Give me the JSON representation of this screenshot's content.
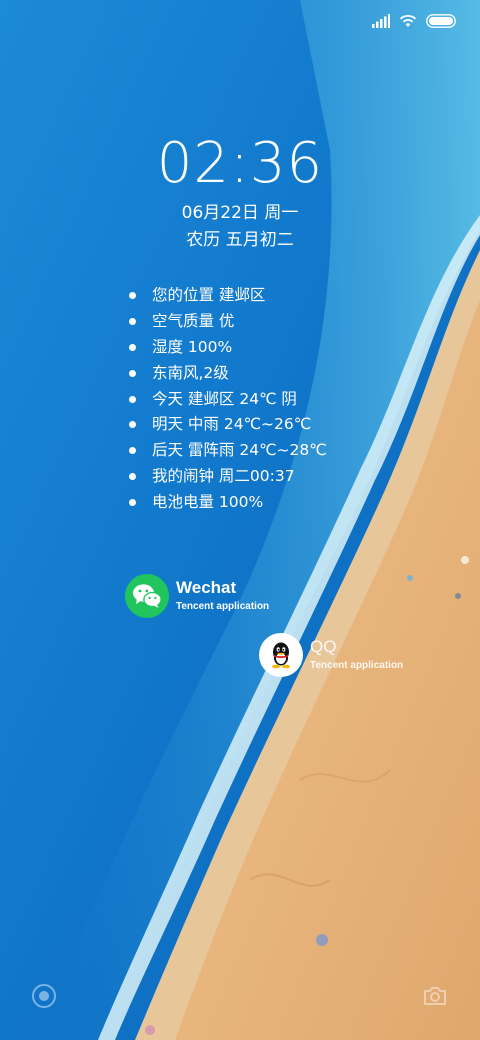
{
  "lockscreen": {
    "time": "02:36",
    "date": "06月22日 周一",
    "lunar_date": "农历 五月初二",
    "info_items": [
      "您的位置 建邺区",
      "空气质量 优",
      "湿度 100%",
      "东南风,2级",
      "今天 建邺区 24℃ 阴",
      "明天 中雨 24℃~26℃",
      "后天 雷阵雨 24℃~28℃",
      "我的闹钟 周二00:37",
      "电池电量 100%"
    ]
  },
  "status_bar": {
    "icons": [
      "signal-icon",
      "wifi-icon",
      "battery-icon"
    ],
    "battery_percent": 100
  },
  "shortcuts": [
    {
      "name": "Wechat",
      "subtitle": "Tencent application",
      "icon": "wechat-icon",
      "color": "#21c55e"
    },
    {
      "name": "QQ",
      "subtitle": "Tencent application",
      "icon": "qq-icon",
      "color": "#ffffff"
    }
  ],
  "bottom_actions": {
    "left_icon": "assistant-icon",
    "right_icon": "camera-icon"
  },
  "colors": {
    "ocean_deep": "#0a6fc4",
    "ocean_light": "#39a6e0",
    "sand": "#e8b57c",
    "wechat_green": "#21c55e"
  }
}
